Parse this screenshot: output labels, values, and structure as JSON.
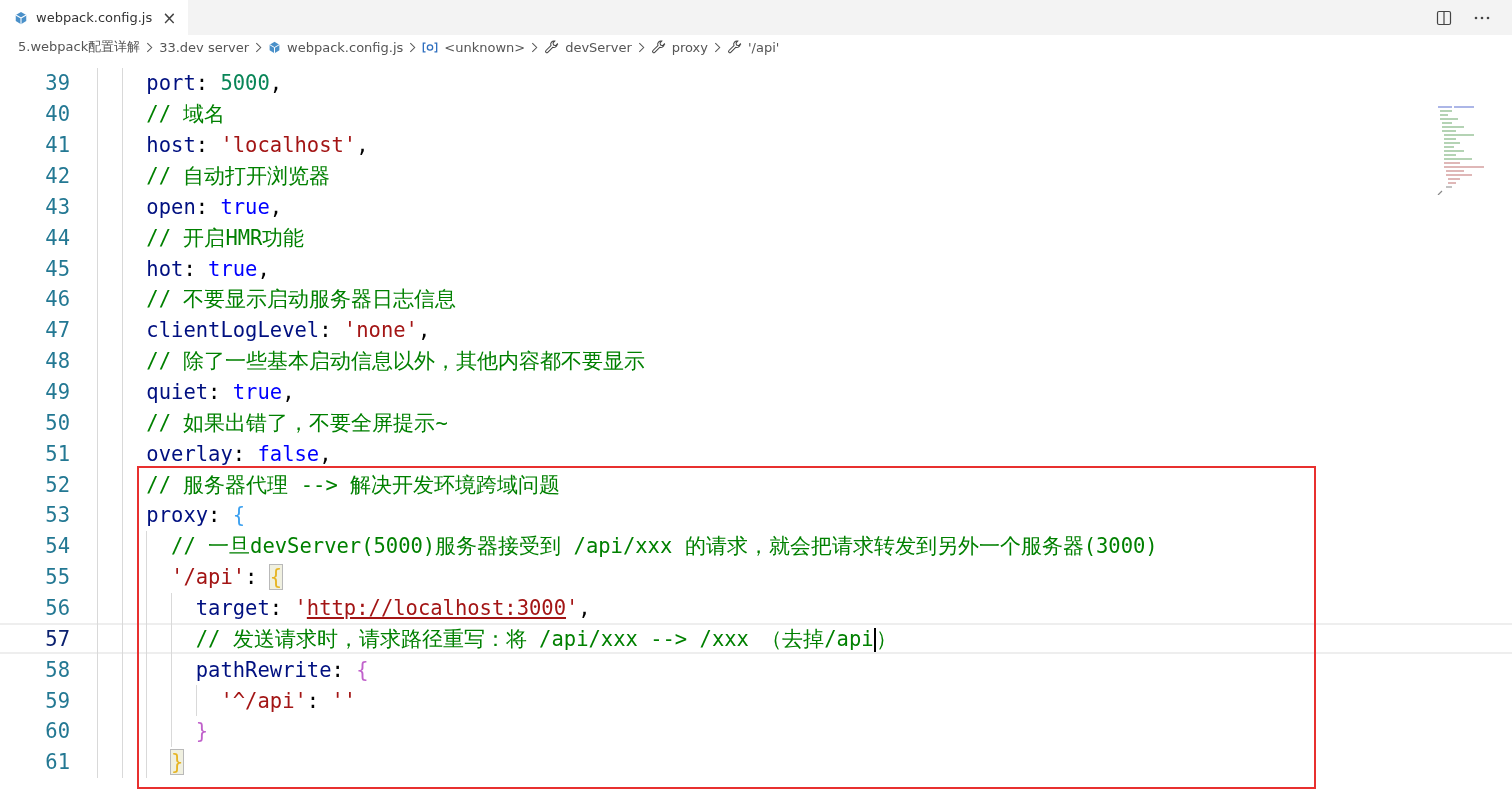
{
  "tab": {
    "label": "webpack.config.js",
    "close": "×",
    "selected": true
  },
  "breadcrumb": [
    {
      "kind": "folder",
      "label": "5.webpack配置详解"
    },
    {
      "kind": "folder",
      "label": "33.dev server"
    },
    {
      "kind": "file",
      "label": "webpack.config.js"
    },
    {
      "kind": "variable",
      "label": "<unknown>"
    },
    {
      "kind": "property",
      "label": "devServer"
    },
    {
      "kind": "property",
      "label": "proxy"
    },
    {
      "kind": "property",
      "label": "'/api'"
    }
  ],
  "editor": {
    "lines": [
      {
        "number": "39",
        "current": false,
        "tokens": [
          {
            "kind": "key",
            "text": "    port"
          },
          {
            "kind": "plain",
            "text": ": "
          },
          {
            "kind": "number",
            "text": "5000"
          },
          {
            "kind": "plain",
            "text": ","
          }
        ]
      },
      {
        "number": "40",
        "current": false,
        "tokens": [
          {
            "kind": "comment",
            "text": "    // 域名"
          }
        ]
      },
      {
        "number": "41",
        "current": false,
        "tokens": [
          {
            "kind": "key",
            "text": "    host"
          },
          {
            "kind": "plain",
            "text": ": "
          },
          {
            "kind": "string",
            "text": "'localhost'"
          },
          {
            "kind": "plain",
            "text": ","
          }
        ]
      },
      {
        "number": "42",
        "current": false,
        "tokens": [
          {
            "kind": "comment",
            "text": "    // 自动打开浏览器"
          }
        ]
      },
      {
        "number": "43",
        "current": false,
        "tokens": [
          {
            "kind": "key",
            "text": "    open"
          },
          {
            "kind": "plain",
            "text": ": "
          },
          {
            "kind": "keyword",
            "text": "true"
          },
          {
            "kind": "plain",
            "text": ","
          }
        ]
      },
      {
        "number": "44",
        "current": false,
        "tokens": [
          {
            "kind": "comment",
            "text": "    // 开启HMR功能"
          }
        ]
      },
      {
        "number": "45",
        "current": false,
        "tokens": [
          {
            "kind": "key",
            "text": "    hot"
          },
          {
            "kind": "plain",
            "text": ": "
          },
          {
            "kind": "keyword",
            "text": "true"
          },
          {
            "kind": "plain",
            "text": ","
          }
        ]
      },
      {
        "number": "46",
        "current": false,
        "tokens": [
          {
            "kind": "comment",
            "text": "    // 不要显示启动服务器日志信息"
          }
        ]
      },
      {
        "number": "47",
        "current": false,
        "tokens": [
          {
            "kind": "key",
            "text": "    clientLogLevel"
          },
          {
            "kind": "plain",
            "text": ": "
          },
          {
            "kind": "string",
            "text": "'none'"
          },
          {
            "kind": "plain",
            "text": ","
          }
        ]
      },
      {
        "number": "48",
        "current": false,
        "tokens": [
          {
            "kind": "comment",
            "text": "    // 除了一些基本启动信息以外，其他内容都不要显示"
          }
        ]
      },
      {
        "number": "49",
        "current": false,
        "tokens": [
          {
            "kind": "key",
            "text": "    quiet"
          },
          {
            "kind": "plain",
            "text": ": "
          },
          {
            "kind": "keyword",
            "text": "true"
          },
          {
            "kind": "plain",
            "text": ","
          }
        ]
      },
      {
        "number": "50",
        "current": false,
        "tokens": [
          {
            "kind": "comment",
            "text": "    // 如果出错了，不要全屏提示~"
          }
        ]
      },
      {
        "number": "51",
        "current": false,
        "tokens": [
          {
            "kind": "key",
            "text": "    overlay"
          },
          {
            "kind": "plain",
            "text": ": "
          },
          {
            "kind": "keyword",
            "text": "false"
          },
          {
            "kind": "plain",
            "text": ","
          }
        ]
      }
    ],
    "boxed_lines": [
      {
        "number": "52",
        "current": false,
        "tokens": [
          {
            "kind": "comment",
            "text": "    // 服务器代理 --> 解决开发环境跨域问题"
          }
        ]
      },
      {
        "number": "53",
        "current": false,
        "tokens": [
          {
            "kind": "key",
            "text": "    proxy"
          },
          {
            "kind": "plain",
            "text": ": "
          },
          {
            "kind": "bracket",
            "text": "{",
            "color": "#3ba0f0",
            "matched": false
          }
        ]
      },
      {
        "number": "54",
        "current": false,
        "tokens": [
          {
            "kind": "comment",
            "text": "      // 一旦devServer(5000)服务器接受到 /api/xxx 的请求，就会把请求转发到另外一个服务器(3000)"
          }
        ]
      },
      {
        "number": "55",
        "current": false,
        "tokens": [
          {
            "kind": "string",
            "text": "      '/api'"
          },
          {
            "kind": "plain",
            "text": ": "
          },
          {
            "kind": "bracket",
            "text": "{",
            "color": "#e6b422",
            "matched": true
          }
        ]
      },
      {
        "number": "56",
        "current": false,
        "tokens": [
          {
            "kind": "key",
            "text": "        target"
          },
          {
            "kind": "plain",
            "text": ": "
          },
          {
            "kind": "string",
            "text": "'"
          },
          {
            "kind": "link",
            "text": "http://localhost:3000"
          },
          {
            "kind": "string",
            "text": "'"
          },
          {
            "kind": "plain",
            "text": ","
          }
        ]
      },
      {
        "number": "57",
        "current": true,
        "tokens": [
          {
            "kind": "comment",
            "text": "        // 发送请求时，请求路径重写：将 /api/xxx --> /xxx （去掉/api"
          },
          {
            "kind": "cursor"
          },
          {
            "kind": "comment",
            "text": "）"
          }
        ]
      },
      {
        "number": "58",
        "current": false,
        "tokens": [
          {
            "kind": "key",
            "text": "        pathRewrite"
          },
          {
            "kind": "plain",
            "text": ": "
          },
          {
            "kind": "bracket",
            "text": "{",
            "color": "#c061cb",
            "matched": false
          }
        ]
      },
      {
        "number": "59",
        "current": false,
        "tokens": [
          {
            "kind": "string",
            "text": "          '^/api'"
          },
          {
            "kind": "plain",
            "text": ": "
          },
          {
            "kind": "string",
            "text": "''"
          }
        ]
      },
      {
        "number": "60",
        "current": false,
        "tokens": [
          {
            "kind": "bracket",
            "text": "        }",
            "color": "#c061cb",
            "matched": false
          }
        ]
      },
      {
        "number": "61",
        "current": false,
        "tokens": [
          {
            "kind": "bracket",
            "text": "      }",
            "color": "#e6b422",
            "matched": true
          }
        ]
      }
    ]
  }
}
